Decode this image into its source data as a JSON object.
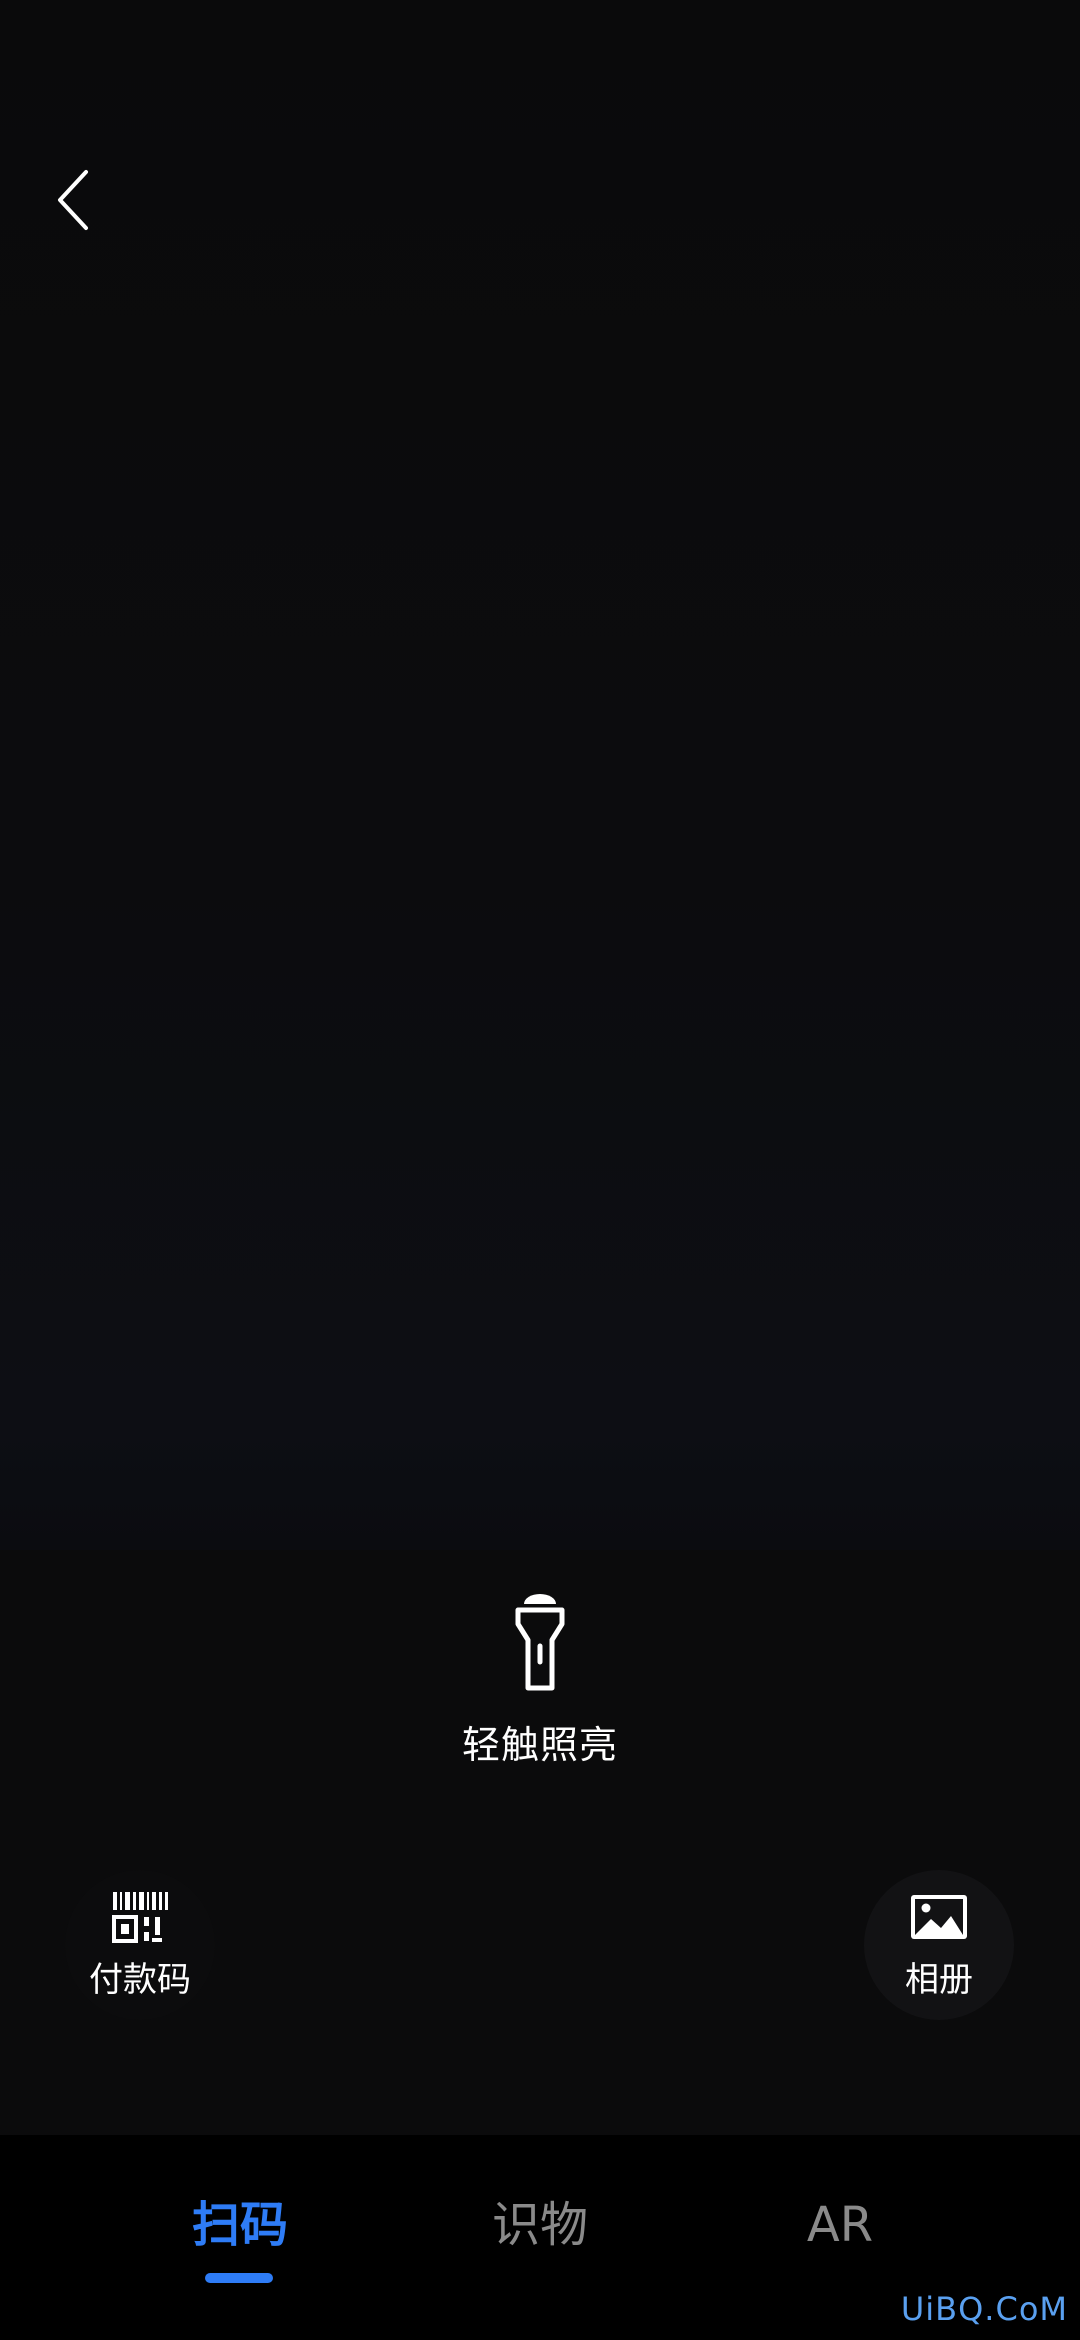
{
  "flashlight": {
    "label": "轻触照亮",
    "icon": "flashlight-icon"
  },
  "payment_code": {
    "label": "付款码",
    "icon": "payment-code-icon"
  },
  "album": {
    "label": "相册",
    "icon": "image-icon"
  },
  "tabs": [
    {
      "label": "扫码",
      "active": true
    },
    {
      "label": "识物",
      "active": false
    },
    {
      "label": "AR",
      "active": false
    }
  ],
  "colors": {
    "accent": "#2e7cf6",
    "inactive_tab": "#8a8a8a",
    "background": "#000000"
  },
  "watermark": "UiBQ.CoM"
}
